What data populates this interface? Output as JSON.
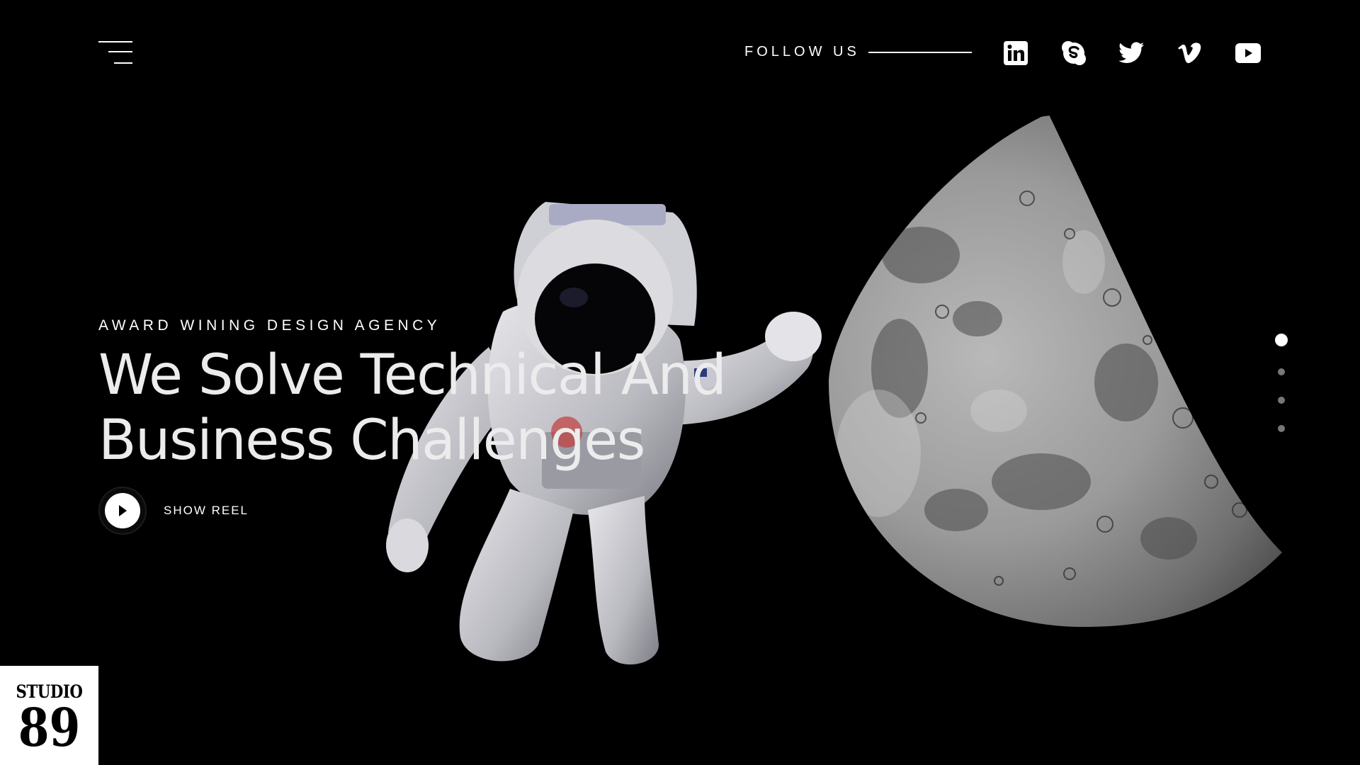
{
  "nav": {
    "menu_icon": "hamburger-menu-icon"
  },
  "social": {
    "follow_label": "FOLLOW US",
    "links": [
      {
        "name": "linkedin",
        "icon": "linkedin-icon"
      },
      {
        "name": "skype",
        "icon": "skype-icon"
      },
      {
        "name": "twitter",
        "icon": "twitter-icon"
      },
      {
        "name": "vimeo",
        "icon": "vimeo-icon"
      },
      {
        "name": "youtube",
        "icon": "youtube-icon"
      }
    ]
  },
  "hero": {
    "eyebrow": "AWARD WINING DESIGN AGENCY",
    "headline_line1": "We Solve Technical And",
    "headline_line2": "Business Challenges",
    "reel_label": "SHOW REEL",
    "reel_icon": "play-icon"
  },
  "pager": {
    "count": 4,
    "active_index": 0
  },
  "brand": {
    "top": "STUDIO",
    "number": "89"
  },
  "colors": {
    "background": "#000000",
    "text": "#ffffff",
    "headline": "#ececec",
    "pager_inactive": "#777777"
  }
}
